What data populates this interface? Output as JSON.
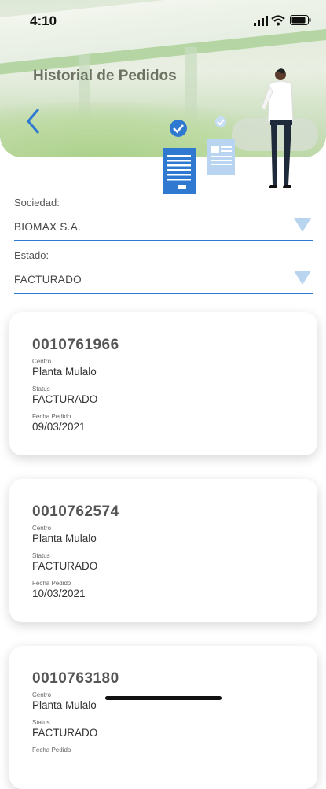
{
  "status_bar": {
    "time": "4:10"
  },
  "header": {
    "title": "Historial de Pedidos"
  },
  "filters": {
    "sociedad": {
      "label": "Sociedad:",
      "value": "BIOMAX S.A."
    },
    "estado": {
      "label": "Estado:",
      "value": "FACTURADO"
    }
  },
  "orders": [
    {
      "number": "0010761966",
      "centro_label": "Centro",
      "centro": "Planta Mulalo",
      "status_label": "Status",
      "status": "FACTURADO",
      "fecha_label": "Fecha Pedido",
      "fecha": "09/03/2021"
    },
    {
      "number": "0010762574",
      "centro_label": "Centro",
      "centro": "Planta Mulalo",
      "status_label": "Status",
      "status": "FACTURADO",
      "fecha_label": "Fecha Pedido",
      "fecha": "10/03/2021"
    },
    {
      "number": "0010763180",
      "centro_label": "Centro",
      "centro": "Planta Mulalo",
      "status_label": "Status",
      "status": "FACTURADO",
      "fecha_label": "Fecha Pedido",
      "fecha": ""
    }
  ],
  "colors": {
    "accent": "#2f7ad0",
    "arrow": "#b8d4ee"
  }
}
